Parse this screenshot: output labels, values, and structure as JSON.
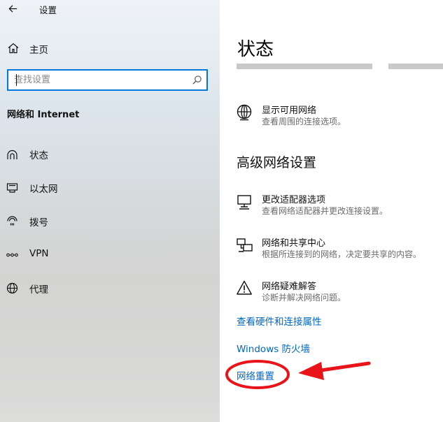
{
  "window": {
    "title": "设置"
  },
  "sidebar": {
    "home_label": "主页",
    "search": {
      "placeholder": "查找设置",
      "value": ""
    },
    "section_title": "网络和 Internet",
    "items": [
      {
        "label": "状态",
        "icon": "home-status-icon"
      },
      {
        "label": "以太网",
        "icon": "ethernet-icon"
      },
      {
        "label": "拨号",
        "icon": "dialup-icon"
      },
      {
        "label": "VPN",
        "icon": "vpn-icon"
      },
      {
        "label": "代理",
        "icon": "globe-icon"
      }
    ]
  },
  "main": {
    "title": "状态",
    "show_networks": {
      "title": "显示可用网络",
      "desc": "查看周围的连接选项。"
    },
    "advanced_heading": "高级网络设置",
    "advanced": [
      {
        "title": "更改适配器选项",
        "desc": "查看网络适配器并更改连接设置。"
      },
      {
        "title": "网络和共享中心",
        "desc": "根据所连接到的网络，决定要共享的内容。"
      },
      {
        "title": "网络疑难解答",
        "desc": "诊断并解决网络问题。"
      }
    ],
    "links": {
      "hardware": "查看硬件和连接属性",
      "firewall": "Windows 防火墙",
      "reset": "网络重置"
    }
  },
  "colors": {
    "accent": "#0078d7",
    "link": "#0067c0",
    "annotation": "#e8141a"
  }
}
